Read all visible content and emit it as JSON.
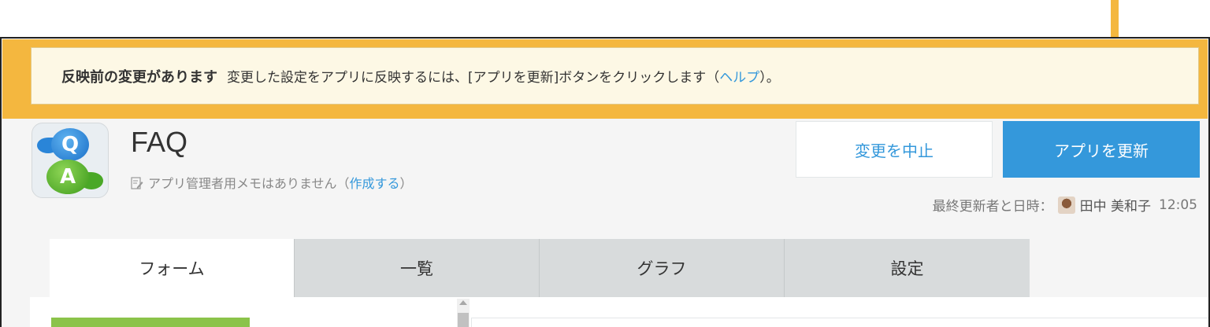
{
  "notice": {
    "title": "反映前の変更があります",
    "body_prefix": "変更した設定をアプリに反映するには、[アプリを更新]ボタンをクリックします（",
    "help_link": "ヘルプ",
    "body_suffix": "）。"
  },
  "app": {
    "icon_q": "Q",
    "icon_a": "A",
    "title": "FAQ",
    "memo_text": "アプリ管理者用メモはありません（",
    "memo_link": "作成する",
    "memo_suffix": "）"
  },
  "actions": {
    "cancel_label": "変更を中止",
    "update_label": "アプリを更新"
  },
  "last_updated": {
    "label": "最終更新者と日時：",
    "user": "田中 美和子",
    "time": "12:05"
  },
  "tabs": [
    {
      "label": "フォーム",
      "active": true
    },
    {
      "label": "一覧",
      "active": false
    },
    {
      "label": "グラフ",
      "active": false
    },
    {
      "label": "設定",
      "active": false
    }
  ],
  "colors": {
    "accent": "#3498db",
    "highlight": "#f4b73f",
    "notice_bg": "#fdf8e5",
    "palette_green": "#8bc34a"
  },
  "icons": {
    "memo": "memo-edit-icon",
    "avatar": "user-avatar"
  }
}
